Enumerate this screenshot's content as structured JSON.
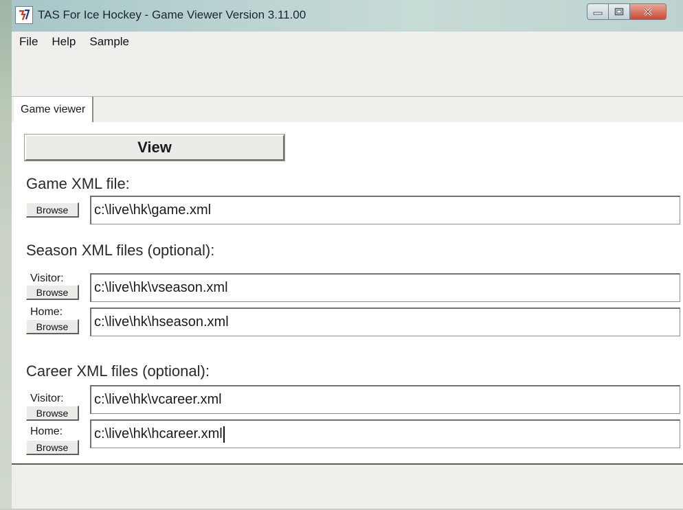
{
  "window": {
    "title": "TAS For Ice Hockey - Game Viewer Version 3.11.00"
  },
  "menu": [
    "File",
    "Help",
    "Sample"
  ],
  "tabs": [
    {
      "label": "Game viewer",
      "active": true
    }
  ],
  "view_button": {
    "label": "View"
  },
  "game": {
    "section_label": "Game XML file:",
    "browse_label": "Browse",
    "path": "c:\\live\\hk\\game.xml"
  },
  "season": {
    "section_label": "Season XML files (optional):",
    "visitor": {
      "label": "Visitor:",
      "browse_label": "Browse",
      "path": "c:\\live\\hk\\vseason.xml"
    },
    "home": {
      "label": "Home:",
      "browse_label": "Browse",
      "path": "c:\\live\\hk\\hseason.xml"
    }
  },
  "career": {
    "section_label": "Career XML files (optional):",
    "visitor": {
      "label": "Visitor:",
      "browse_label": "Browse",
      "path": "c:\\live\\hk\\vcareer.xml"
    },
    "home": {
      "label": "Home:",
      "browse_label": "Browse",
      "path": "c:\\live\\hk\\hcareer.xml"
    }
  },
  "icons": {
    "app": "app-logo-icon",
    "minimize": "minimize-icon",
    "maximize": "maximize-icon",
    "close": "close-icon"
  },
  "colors": {
    "titlebar": "#b8d2d1",
    "close_button": "#c84a33",
    "panel_bg": "#ffffff",
    "chrome_bg": "#f0efec"
  }
}
